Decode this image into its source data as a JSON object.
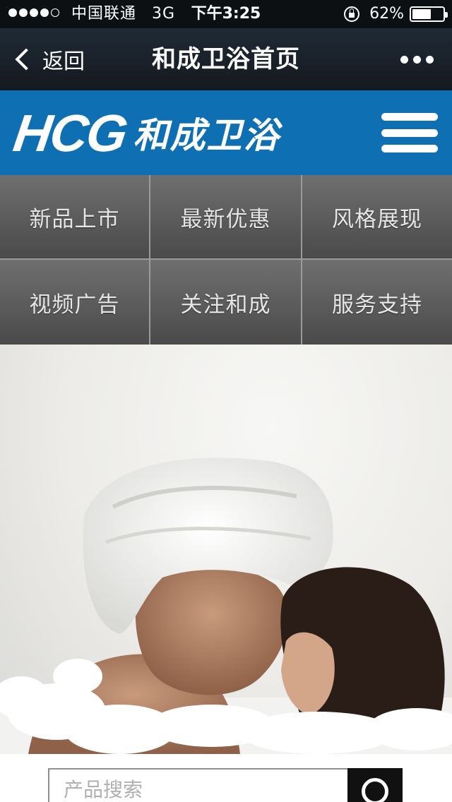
{
  "status_bar": {
    "carrier": "中国联通",
    "network": "3G",
    "time": "下午3:25",
    "battery_percent": "62%",
    "battery_level": 0.62,
    "signal_bars_filled": 4
  },
  "nav_bar": {
    "back_label": "返回",
    "title": "和成卫浴首页",
    "more_icon": "more-dots-icon"
  },
  "brand": {
    "logo_mark": "HCG",
    "logo_text": "和成卫浴",
    "menu_icon": "hamburger-menu-icon",
    "color": "#0f6fb3"
  },
  "menu": {
    "items": [
      {
        "label": "新品上市"
      },
      {
        "label": "最新优惠"
      },
      {
        "label": "风格展现"
      },
      {
        "label": "视频广告"
      },
      {
        "label": "关注和成"
      },
      {
        "label": "服务支持"
      }
    ]
  },
  "hero": {
    "image_subject": "photo"
  },
  "search": {
    "placeholder": "产品搜索",
    "value": "",
    "button_icon": "search-icon"
  }
}
